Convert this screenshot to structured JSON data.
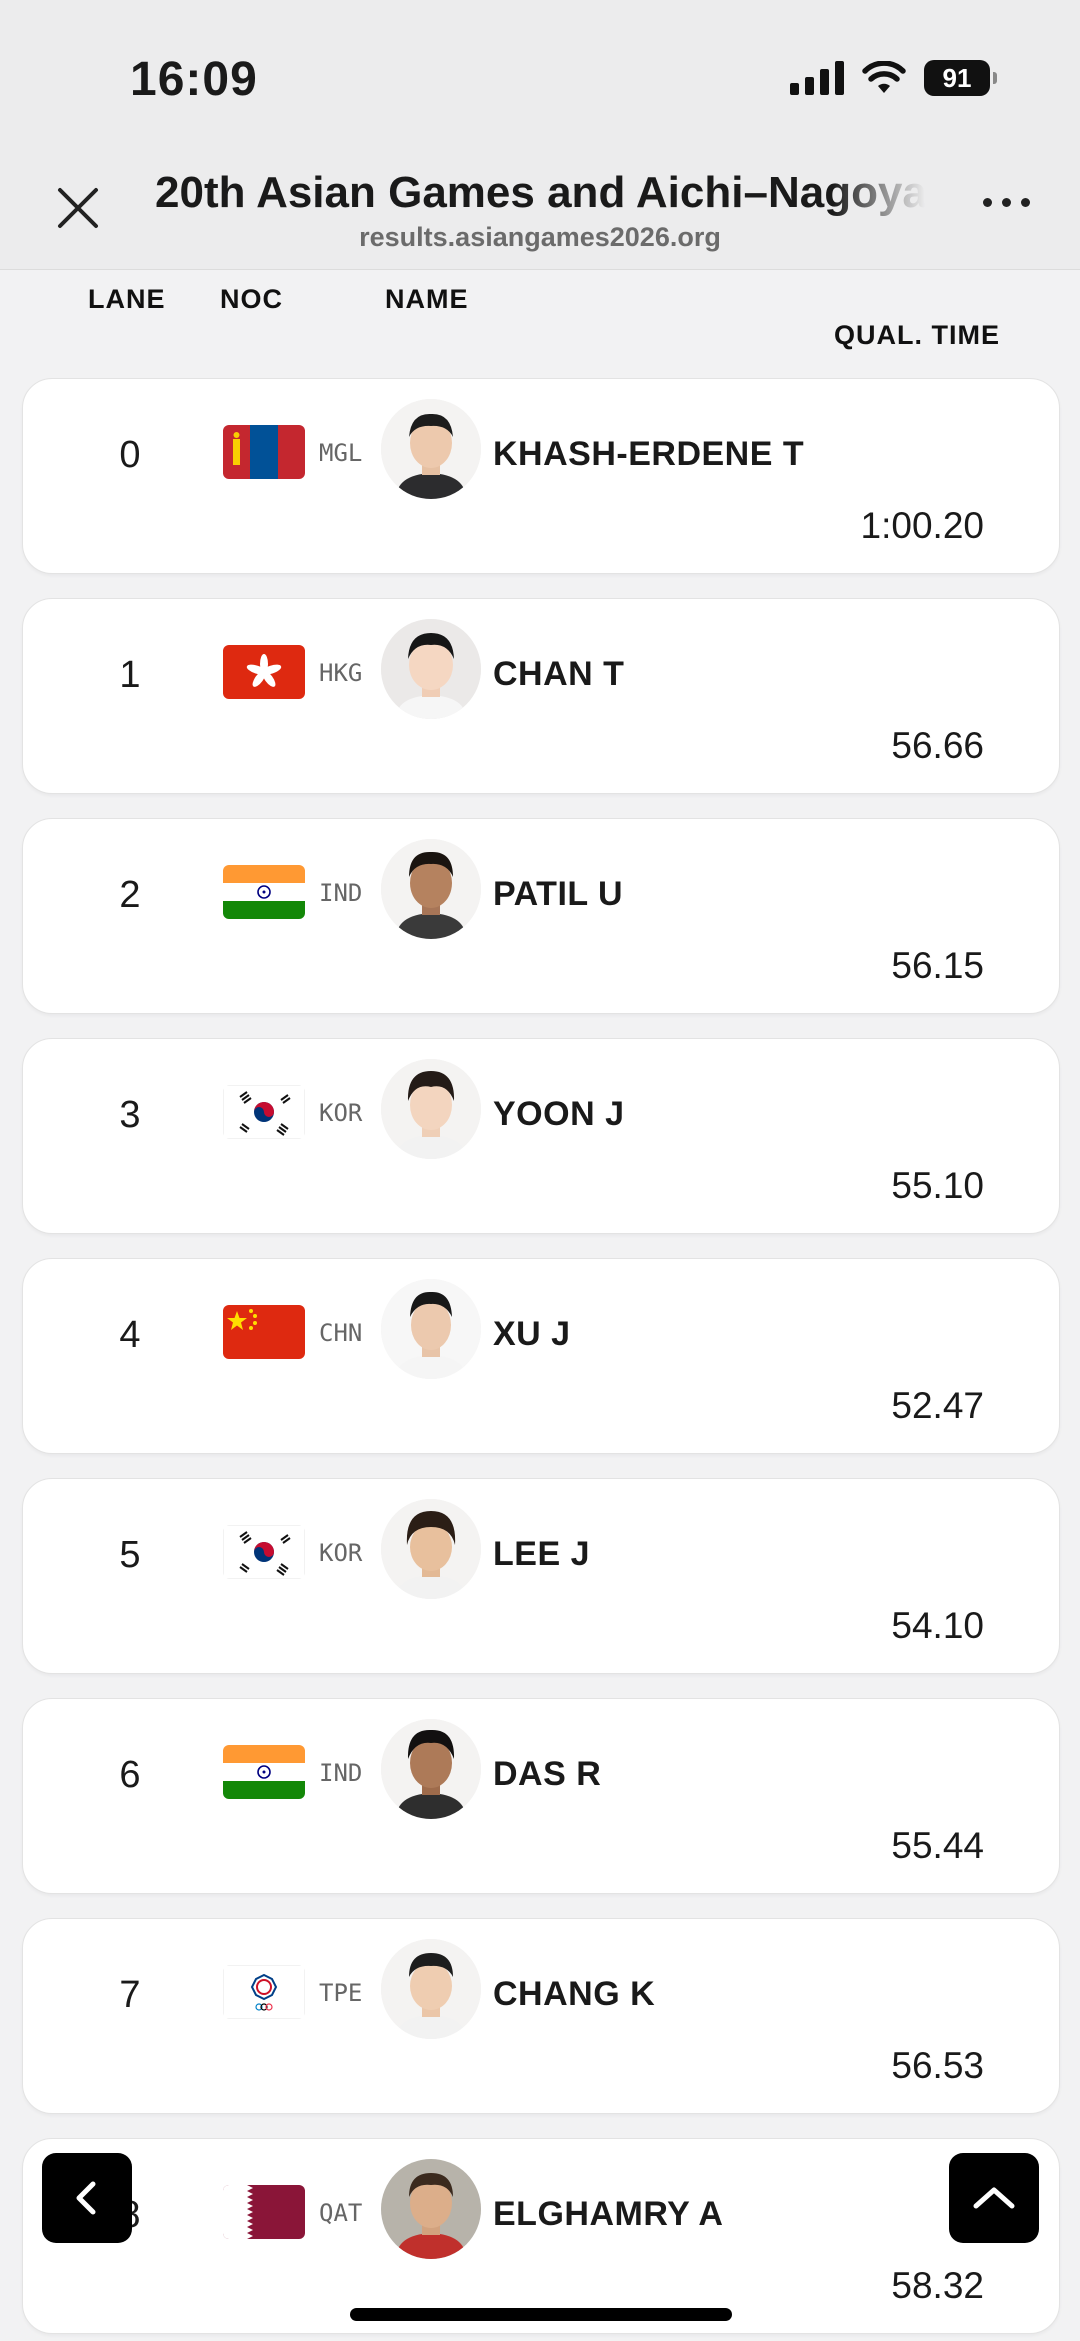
{
  "status_bar": {
    "time": "16:09",
    "battery": "91"
  },
  "browser": {
    "title": "20th Asian Games and Aichi–Nagoya",
    "url": "results.asiangames2026.org"
  },
  "columns": {
    "lane": "LANE",
    "noc": "NOC",
    "name": "NAME",
    "qual_time": "QUAL. TIME"
  },
  "rows": [
    {
      "lane": "0",
      "noc": "MGL",
      "name": "KHASH-ERDENE T",
      "qual_time": "1:00.20"
    },
    {
      "lane": "1",
      "noc": "HKG",
      "name": "CHAN T",
      "qual_time": "56.66"
    },
    {
      "lane": "2",
      "noc": "IND",
      "name": "PATIL U",
      "qual_time": "56.15"
    },
    {
      "lane": "3",
      "noc": "KOR",
      "name": "YOON J",
      "qual_time": "55.10"
    },
    {
      "lane": "4",
      "noc": "CHN",
      "name": "XU J",
      "qual_time": "52.47"
    },
    {
      "lane": "5",
      "noc": "KOR",
      "name": "LEE J",
      "qual_time": "54.10"
    },
    {
      "lane": "6",
      "noc": "IND",
      "name": "DAS R",
      "qual_time": "55.44"
    },
    {
      "lane": "7",
      "noc": "TPE",
      "name": "CHANG K",
      "qual_time": "56.53"
    },
    {
      "lane": "8",
      "noc": "QAT",
      "name": "ELGHAMRY A",
      "qual_time": "58.32"
    }
  ],
  "icons": {
    "close": "close-icon",
    "more": "more-dots-icon",
    "back": "chevron-left-icon",
    "scroll_top": "chevron-up-icon"
  }
}
